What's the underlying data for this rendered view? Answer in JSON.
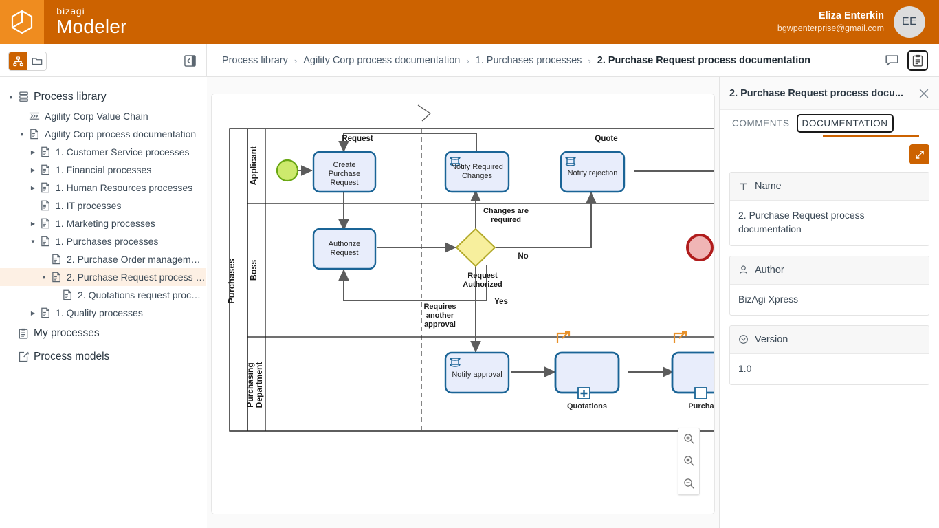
{
  "header": {
    "brand_small": "bizagi",
    "brand_big": "Modeler",
    "user_name": "Eliza Enterkin",
    "user_email": "bgwpenterprise@gmail.com",
    "avatar_initials": "EE",
    "logo_icon": "bizagi-cube-icon",
    "accent_color": "#cc6200",
    "logo_bg_color": "#ef8c1f"
  },
  "toolbar": {
    "view_tree_icon": "org-tree-icon",
    "view_folder_icon": "folder-icon",
    "collapse_icon": "collapse-panel-icon",
    "comments_icon": "comment-bubble-icon",
    "documentation_icon": "clipboard-document-icon"
  },
  "breadcrumb": {
    "separator": "›",
    "items": [
      {
        "label": "Process library",
        "current": false
      },
      {
        "label": "Agility Corp process documentation",
        "current": false
      },
      {
        "label": "1. Purchases processes",
        "current": false
      },
      {
        "label": "2. Purchase Request process documentation",
        "current": true
      }
    ]
  },
  "sidebar": {
    "items": [
      {
        "label": "Process library",
        "indent": 0,
        "caret": "down",
        "icon": "library-icon",
        "style": "root",
        "selected": false
      },
      {
        "label": "Agility Corp Value Chain",
        "indent": 1,
        "caret": "none",
        "icon": "chain-icon",
        "style": "normal",
        "selected": false
      },
      {
        "label": "Agility Corp process documentation",
        "indent": 1,
        "caret": "down",
        "icon": "process-icon",
        "style": "normal",
        "selected": false
      },
      {
        "label": "1. Customer Service processes",
        "indent": 2,
        "caret": "right",
        "icon": "process-icon",
        "style": "normal",
        "selected": false
      },
      {
        "label": "1. Financial processes",
        "indent": 2,
        "caret": "right",
        "icon": "process-icon",
        "style": "normal",
        "selected": false
      },
      {
        "label": "1. Human Resources processes",
        "indent": 2,
        "caret": "right",
        "icon": "process-icon",
        "style": "normal",
        "selected": false
      },
      {
        "label": "1. IT processes",
        "indent": 2,
        "caret": "none",
        "icon": "process-icon",
        "style": "normal",
        "selected": false
      },
      {
        "label": "1. Marketing processes",
        "indent": 2,
        "caret": "right",
        "icon": "process-icon",
        "style": "normal",
        "selected": false
      },
      {
        "label": "1. Purchases processes",
        "indent": 2,
        "caret": "down",
        "icon": "process-icon",
        "style": "normal",
        "selected": false
      },
      {
        "label": "2. Purchase Order management ...",
        "indent": 3,
        "caret": "none",
        "icon": "process-icon",
        "style": "normal",
        "selected": false
      },
      {
        "label": "2. Purchase Request process do...",
        "indent": 3,
        "caret": "down",
        "icon": "process-icon",
        "style": "normal",
        "selected": true
      },
      {
        "label": "2. Quotations request process...",
        "indent": 4,
        "caret": "none",
        "icon": "process-icon",
        "style": "normal",
        "selected": false
      },
      {
        "label": "1. Quality processes",
        "indent": 2,
        "caret": "right",
        "icon": "process-icon",
        "style": "normal",
        "selected": false
      },
      {
        "label": "My processes",
        "indent": 0,
        "caret": "none",
        "icon": "clipboard-icon",
        "style": "big",
        "selected": false
      },
      {
        "label": "Process models",
        "indent": 0,
        "caret": "none",
        "icon": "edit-doc-icon",
        "style": "big",
        "selected": false
      }
    ]
  },
  "canvas": {
    "zoom_in_icon": "zoom-in-icon",
    "zoom_reset_icon": "zoom-fit-icon",
    "zoom_out_icon": "zoom-out-icon",
    "diagram": {
      "pool_label": "Purchases",
      "lanes": [
        "Applicant",
        "Boss",
        "Purchasing Department"
      ],
      "tasks": [
        {
          "id": "create",
          "label": "Create Purchase Request"
        },
        {
          "id": "notifychg",
          "label": "Notify Required Changes"
        },
        {
          "id": "notifyrej",
          "label": "Notify rejection"
        },
        {
          "id": "authorize",
          "label": "Authorize Request"
        },
        {
          "id": "notifyapp",
          "label": "Notify approval"
        }
      ],
      "subprocesses": [
        {
          "id": "quotations",
          "label": "Quotations"
        },
        {
          "id": "purchase",
          "label": "Purcha"
        }
      ],
      "gateway_label": "Request Authorized",
      "flow_labels": [
        "Request",
        "Quote",
        "Changes are required",
        "No",
        "Yes",
        "Requires another approval"
      ],
      "colors": {
        "task_fill": "#e8edfb",
        "task_stroke": "#1a6496",
        "start_fill": "#cdea6d",
        "start_stroke": "#6aa814",
        "gateway_fill": "#f7ef9d",
        "gateway_stroke": "#b3aa2b",
        "end_fill": "#f0b5b5",
        "end_stroke": "#b01c1c",
        "link_icon": "#e8912a"
      }
    }
  },
  "right_panel": {
    "title": "2. Purchase Request process docu...",
    "close_icon": "close-icon",
    "tabs": [
      {
        "label": "COMMENTS",
        "active": false
      },
      {
        "label": "DOCUMENTATION",
        "active": true
      }
    ],
    "expand_icon": "expand-diagonal-icon",
    "fields": [
      {
        "icon": "text-format-icon",
        "label": "Name",
        "value": "2. Purchase Request process documentation"
      },
      {
        "icon": "person-icon",
        "label": "Author",
        "value": "BizAgi Xpress"
      },
      {
        "icon": "clock-icon",
        "label": "Version",
        "value": "1.0"
      }
    ]
  }
}
